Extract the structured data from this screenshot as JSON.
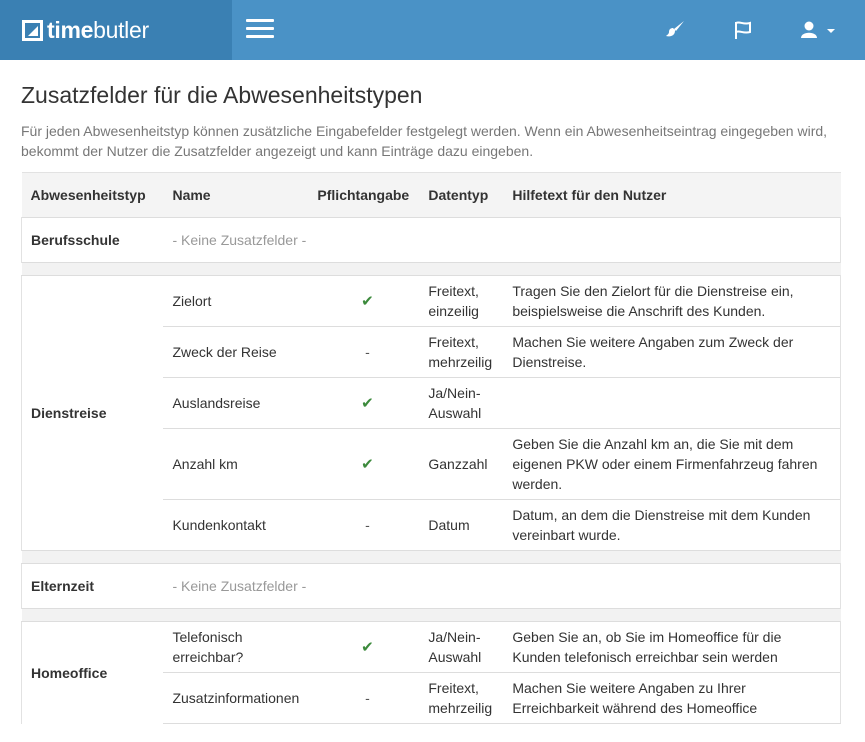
{
  "brand": {
    "bold": "time",
    "light": "butler"
  },
  "page": {
    "title": "Zusatzfelder für die Abwesenheitstypen",
    "intro": "Für jeden Abwesenheitstyp können zusätzliche Eingabefelder festgelegt werden. Wenn ein Abwesenheitseintrag eingegeben wird, bekommt der Nutzer die Zusatzfelder angezeigt und kann Einträge dazu eingeben."
  },
  "table": {
    "headers": [
      "Abwesenheitstyp",
      "Name",
      "Pflichtangabe",
      "Datentyp",
      "Hilfetext für den Nutzer"
    ],
    "empty_label": "- Keine Zusatzfelder -",
    "groups": [
      {
        "type": "Berufsschule",
        "fields": []
      },
      {
        "type": "Dienstreise",
        "fields": [
          {
            "name": "Zielort",
            "required": "check",
            "datatype": "Freitext, einzeilig",
            "help": "Tragen Sie den Zielort für die Dienstreise ein, beispielsweise die Anschrift des Kunden."
          },
          {
            "name": "Zweck der Reise",
            "required": "-",
            "datatype": "Freitext, mehrzeilig",
            "help": "Machen Sie weitere Angaben zum Zweck der Dienstreise."
          },
          {
            "name": "Auslandsreise",
            "required": "check",
            "datatype": "Ja/Nein-Auswahl",
            "help": ""
          },
          {
            "name": "Anzahl km",
            "required": "check",
            "datatype": "Ganzzahl",
            "help": "Geben Sie die Anzahl km an, die Sie mit dem eigenen PKW oder einem Firmenfahrzeug fahren werden."
          },
          {
            "name": "Kundenkontakt",
            "required": "-",
            "datatype": "Datum",
            "help": "Datum, an dem die Dienstreise mit dem Kunden vereinbart wurde."
          }
        ]
      },
      {
        "type": "Elternzeit",
        "fields": []
      },
      {
        "type": "Homeoffice",
        "fields": [
          {
            "name": "Telefonisch erreichbar?",
            "required": "check",
            "datatype": "Ja/Nein-Auswahl",
            "help": "Geben Sie an, ob Sie im Homeoffice für die Kunden telefonisch erreichbar sein werden"
          },
          {
            "name": "Zusatzinformationen",
            "required": "-",
            "datatype": "Freitext, mehrzeilig",
            "help": "Machen Sie weitere Angaben zu Ihrer Erreichbarkeit während des Homeoffice"
          }
        ]
      }
    ]
  },
  "icons": {
    "check": "✔",
    "brush": "brush-icon",
    "flag": "flag-icon",
    "user": "user-icon"
  },
  "colors": {
    "topbar": "#4a92c6",
    "brand_bg": "#3a80b3",
    "check": "#3c8a3c"
  }
}
